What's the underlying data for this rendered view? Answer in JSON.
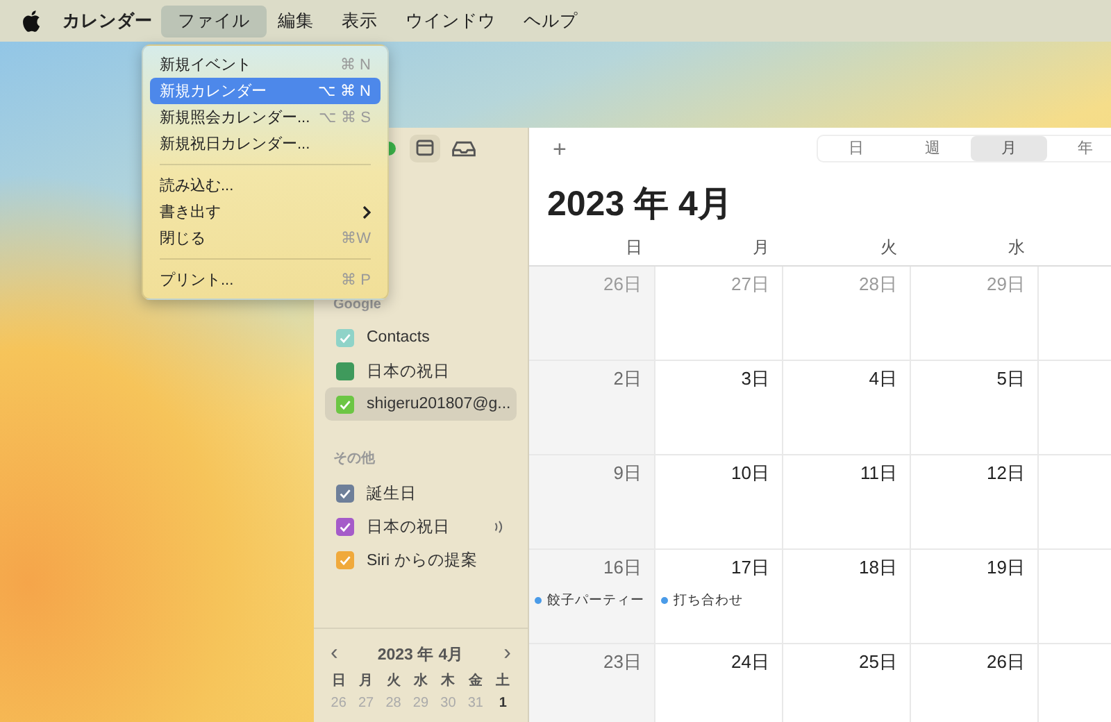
{
  "menu_bar": {
    "app_name": "カレンダー",
    "menus": [
      {
        "label": "ファイル",
        "selected": true
      },
      {
        "label": "編集",
        "selected": false
      },
      {
        "label": "表示",
        "selected": false
      },
      {
        "label": "ウインドウ",
        "selected": false
      },
      {
        "label": "ヘルプ",
        "selected": false
      }
    ]
  },
  "file_menu": {
    "items": [
      {
        "kind": "item",
        "label": "新規イベント",
        "shortcut": "⌘ N",
        "selected": false
      },
      {
        "kind": "item",
        "label": "新規カレンダー",
        "shortcut": "⌥ ⌘ N",
        "selected": true
      },
      {
        "kind": "item",
        "label": "新規照会カレンダー...",
        "shortcut": "⌥ ⌘ S",
        "selected": false
      },
      {
        "kind": "item",
        "label": "新規祝日カレンダー...",
        "selected": false
      },
      {
        "kind": "separator"
      },
      {
        "kind": "item",
        "label": "読み込む...",
        "selected": false
      },
      {
        "kind": "submenu",
        "label": "書き出す",
        "selected": false
      },
      {
        "kind": "item",
        "label": "閉じる",
        "shortcut": "⌘W",
        "selected": false
      },
      {
        "kind": "separator"
      },
      {
        "kind": "item",
        "label": "プリント...",
        "shortcut": "⌘ P",
        "selected": false
      }
    ]
  },
  "sidebar": {
    "groups": [
      {
        "title": "Google",
        "items": [
          {
            "label": "Contacts",
            "color": "#8fd3c8",
            "checked": true,
            "selected": false
          },
          {
            "label": "日本の祝日",
            "color": "#3f9a5c",
            "checked": false,
            "selected": false
          },
          {
            "label": "shigeru201807@g...",
            "color": "#6cc644",
            "checked": true,
            "selected": true
          }
        ]
      },
      {
        "title": "その他",
        "items": [
          {
            "label": "誕生日",
            "color": "#6e7f99",
            "checked": true,
            "selected": false
          },
          {
            "label": "日本の祝日",
            "color": "#a55bc9",
            "checked": true,
            "selected": false,
            "broadcast": true
          },
          {
            "label": "Siri からの提案",
            "color": "#f0a93b",
            "checked": true,
            "selected": false
          }
        ]
      }
    ],
    "mini_calendar": {
      "title": "2023 年 4月",
      "prev": "‹",
      "next": "›",
      "weekdays": [
        "日",
        "月",
        "火",
        "水",
        "木",
        "金",
        "土"
      ],
      "days": [
        {
          "label": "26",
          "muted": true
        },
        {
          "label": "27",
          "muted": true
        },
        {
          "label": "28",
          "muted": true
        },
        {
          "label": "29",
          "muted": true
        },
        {
          "label": "30",
          "muted": true
        },
        {
          "label": "31",
          "muted": true
        },
        {
          "label": "1",
          "muted": false
        }
      ]
    }
  },
  "toolbar": {
    "add": "+",
    "views": [
      {
        "label": "日",
        "selected": false
      },
      {
        "label": "週",
        "selected": false
      },
      {
        "label": "月",
        "selected": true
      },
      {
        "label": "年",
        "selected": false
      }
    ]
  },
  "month": {
    "title": "2023 年 4月",
    "weekdays": [
      "日",
      "月",
      "火",
      "水"
    ],
    "weeks": [
      [
        {
          "day": "26日",
          "muted": true
        },
        {
          "day": "27日",
          "muted": true
        },
        {
          "day": "28日",
          "muted": true
        },
        {
          "day": "29日",
          "muted": true
        }
      ],
      [
        {
          "day": "2日",
          "muted": false
        },
        {
          "day": "3日",
          "muted": false
        },
        {
          "day": "4日",
          "muted": false
        },
        {
          "day": "5日",
          "muted": false
        }
      ],
      [
        {
          "day": "9日",
          "muted": false
        },
        {
          "day": "10日",
          "muted": false
        },
        {
          "day": "11日",
          "muted": false
        },
        {
          "day": "12日",
          "muted": false
        }
      ],
      [
        {
          "day": "16日",
          "muted": false,
          "events": [
            {
              "title": "餃子パーティー",
              "color": "#4a9be8"
            }
          ]
        },
        {
          "day": "17日",
          "muted": false,
          "events": [
            {
              "title": "打ち合わせ",
              "color": "#4a9be8"
            }
          ]
        },
        {
          "day": "18日",
          "muted": false
        },
        {
          "day": "19日",
          "muted": false
        }
      ],
      [
        {
          "day": "23日",
          "muted": false
        },
        {
          "day": "24日",
          "muted": false
        },
        {
          "day": "25日",
          "muted": false
        },
        {
          "day": "26日",
          "muted": false
        }
      ]
    ]
  }
}
